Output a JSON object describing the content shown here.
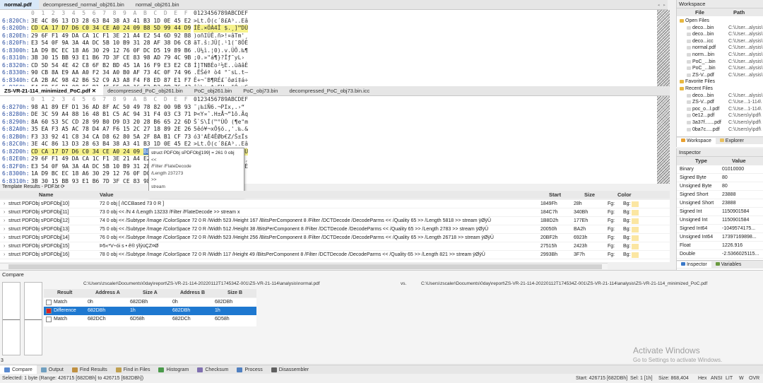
{
  "top_tabs": [
    "normal.pdf",
    "decompressed_normal_obj261.bin",
    "normal_obj261.bin"
  ],
  "hex_header": {
    "addr": "",
    "cols": "0  1  2  3  4  5  6  7  8  9  A  B  C  D  E  F",
    "ascii": "0123456789ABCDEF"
  },
  "hex_top": [
    {
      "a": "6:820Ch:",
      "b": "3E 4C 86 13 D3 28 63 B4 38 A3 41 B3 1D 0E 45 E2",
      "t": ">Lt.Ó(c´8£A³..Eâ"
    },
    {
      "a": "6:820Dh:",
      "b": "CD CA 17 D7 D6 C0 34 CE A0 24 09 B8 5D 99 44 D9",
      "t": "ÍÊ.×ÖÀ4Î $.¸]™DÙ",
      "hl": true
    },
    {
      "a": "6:820Eh:",
      "b": "29 6F F1 49 DA CA 1C F1 3E 21 A4 E2 54 6D 92 B8",
      "t": ")oñIÚÊ.ñ>!¤âTm'¸"
    },
    {
      "a": "6:820Fh:",
      "b": "E3 54 0F 9A 3A 4A DC 5B 10 B9 31 28 AF 38 D6 C8",
      "t": "ãT.š:JÜ[.¹1(¯8ÖÈ"
    },
    {
      "a": "6:8300h:",
      "b": "1A D9 BC EC 18 A6 30 29 12 76 0F DC D5 19 89 B6",
      "t": ".Ù¼ì.¦0).v.ÜÕ.‰¶"
    },
    {
      "a": "6:8310h:",
      "b": "3B 30 15 BB 93 E1 B6 7D 3F CE 83 98 AD 79 4C 9B",
      "t": ";0.»\"á¶}?Îƒ˜­yL›"
    },
    {
      "a": "6:8320h:",
      "b": "CD 5D 54 4E 42 C8 6F B2 BD 45 1A 16 F9 E3 E2 C8",
      "t": "Í]TNBÈo²½E..ùãâÈ"
    },
    {
      "a": "6:8330h:",
      "b": "90 CB 8A E9 AA A0 F2 34 A0 B0 AF 73 4C 0F 74 96",
      "t": ".ËŠéª ò4 °¯sL.t–"
    },
    {
      "a": "6:8340h:",
      "b": "CA 2B AC 98 42 B6 52 C9 A3 A8 F4 F8 ED 87 E1 F7",
      "t": "Ê+¬˜B¶RÉ£¨ôøí‡á÷"
    },
    {
      "a": "6:8350h:",
      "b": "F4 F9 5C B1 08 86 B1 45 55 09 16 E3 D3 9B 76 43",
      "t": "ôù\\±.†±EU..ãÓ›vC"
    }
  ],
  "mid_tabs": [
    "ZS-VR-21-114_minimized_PoC.pdf",
    "decompressed_PoC_obj261.bin",
    "PoC_obj261.bin",
    "PoC_obj73.bin",
    "decompressed_PoC_obj73.bin.icc"
  ],
  "hex_bottom": [
    {
      "a": "6:8270h:",
      "b": "98 A1 89 EF D1 36 AD 8F AC 50 49 78 82 00 9B 93",
      "t": "˜¡‰ïÑ6­.¬PIx‚.›“"
    },
    {
      "a": "6:8280h:",
      "b": "DE 3C 59 A4 88 16 48 B1 C5 AC 94 31 F4 03 C3 71",
      "t": "Þ<Y¤ˆ.H±Å¬”1ô.Ãq"
    },
    {
      "a": "6:8290h:",
      "b": "8A 60 53 5C CD 28 99 B0 D9 D3 20 28 B6 65 22 6D",
      "t": "Š`S\\Í(™°ÙÓ (¶e\"m"
    },
    {
      "a": "6:82A0h:",
      "b": "35 EA F3 A5 AC 78 D4 A7 F6 15 2C 27 18 89 2E 26",
      "t": "5êó¥¬xÔ§ö.,'.‰.&"
    },
    {
      "a": "6:82B0h:",
      "b": "F3 33 92 41 C8 34 CA D8 62 80 5A 2F 8A B1 CF 73",
      "t": "ó3'AÈ4ÊØb€Z/Š±Ïs"
    },
    {
      "a": "6:82C0h:",
      "b": "3E 4C 86 13 D3 28 63 B4 38 A3 41 B3 1D 0E 45 E2",
      "t": ">Lt.Ó(c´8£A³..Eâ"
    },
    {
      "a": "6:82D0h:",
      "b": "CD CA 17 D7 D6 C0 34 CE A0 24 09 B8 5D 99 44 D9",
      "t": "ÍÊ.×ÖÀ4Î $.¸]™DÙ",
      "hl": true
    },
    {
      "a": "6:82E0h:",
      "b": "29 6F F1 49 DA CA 1C F1 3E 21 A4 E2 54 6D 92 B8",
      "t": ")oñIÚÊ.ñ>!¤âTm'¸"
    },
    {
      "a": "6:82F0h:",
      "b": "E3 54 0F 9A 3A 4A DC 5B 10 B9 31 28 AF 38 D6 C8",
      "t": "ãT.š:JÜ[.¹1(¯8ÖÈ"
    },
    {
      "a": "6:8300h:",
      "b": "1A D9 BC EC 18 A6 30 29 12 76 0F DC",
      "t": ""
    },
    {
      "a": "6:8310h:",
      "b": "3B 30 15 BB 93 E1 B6 7D 3F CE 83 98",
      "t": ""
    },
    {
      "a": "6:8320h:",
      "b": "CD 5D 54 4E 42 C8 6F B2 BD 45 1A 16",
      "t": ""
    }
  ],
  "tooltip": [
    "struct PDFObj sPDFObj[199] = 261 0 obj",
    "<<",
    "/Filter /FlateDecode",
    "/Length 237273",
    ">>",
    "stream",
    "x"
  ],
  "template": {
    "title": "Template Results - PDF.bt ⟳",
    "headers": [
      "Name",
      "Value",
      "Start",
      "Size",
      "Color"
    ],
    "rows": [
      {
        "n": "struct PDFObj sPDFObj[10]",
        "v": "72 0 obj   [ /ICCBased 73 0 R ]",
        "s": "1849Fh",
        "z": "28h",
        "fg": "Fg:",
        "bg": "Bg:"
      },
      {
        "n": "struct PDFObj sPDFObj[11]",
        "v": "73 0 obj   << /N 4  /Length 13233  /Filter /FlateDecode  >>  stream  x",
        "s": "184C7h",
        "z": "340Bh",
        "fg": "Fg:",
        "bg": "Bg:"
      },
      {
        "n": "struct PDFObj sPDFObj[12]",
        "v": "74 0 obj   << /Subtype /Image  /ColorSpace 72 0 R  /Width 523  /Height 167  /BitsPerComponent 8  /Filter /DCTDecode  /DecodeParms << /Quality 65 >>  /Length 5818  >>  stream  ÿØÿÛ",
        "s": "1B8D2h",
        "z": "177Eh",
        "fg": "Fg:",
        "bg": "Bg:"
      },
      {
        "n": "struct PDFObj sPDFObj[13]",
        "v": "75 0 obj   << /Subtype /Image  /ColorSpace 72 0 R  /Width 512  /Height 38  /BitsPerComponent 8  /Filter /DCTDecode  /DecodeParms << /Quality 65 >>  /Length 2783  >>  stream  ÿØÿÛ",
        "s": "20050h",
        "z": "BA2h",
        "fg": "Fg:",
        "bg": "Bg:"
      },
      {
        "n": "struct PDFObj sPDFObj[14]",
        "v": "76 0 obj   << /Subtype /Image  /ColorSpace 72 0 R  /Width 523  /Height 256  /BitsPerComponent 8  /Filter /DCTDecode  /DecodeParms << /Quality 65 >>  /Length 26718  >>  stream  ÿØÿÛ",
        "s": "20BF2h",
        "z": "6923h",
        "fg": "Fg:",
        "bg": "Bg:"
      },
      {
        "n": "struct PDFObj sPDFObj[15]",
        "v": "Þ5«*V÷ói  s  •  ê®   ÿÏýüÇZ¤Ø",
        "s": "27515h",
        "z": "2423h",
        "fg": "Fg:",
        "bg": "Bg:"
      },
      {
        "n": "struct PDFObj sPDFObj[16]",
        "v": "78 0 obj   << /Subtype /Image  /ColorSpace 72 0 R  /Width 117  /Height 49  /BitsPerComponent 8  /Filter /DCTDecode  /DecodeParms << /Quality 65 >>  /Length 821  >>  stream  ÿØÿÛ",
        "s": "2993Bh",
        "z": "3F7h",
        "fg": "Fg:",
        "bg": "Bg:"
      }
    ]
  },
  "workspace": {
    "title": "Workspace",
    "headers": [
      "File",
      "Path"
    ],
    "tree": [
      {
        "k": "folder",
        "f": "Open Files",
        "p": ""
      },
      {
        "k": "file",
        "f": "deco...bin",
        "p": "C:\\User...alysis\\"
      },
      {
        "k": "file",
        "f": "deco...bin",
        "p": "C:\\User...alysis\\"
      },
      {
        "k": "file",
        "f": "deco...icc",
        "p": "C:\\User...alysis\\"
      },
      {
        "k": "file",
        "f": "normal.pdf",
        "p": "C:\\User...alysis\\"
      },
      {
        "k": "file",
        "f": "norm...bin",
        "p": "C:\\User...alysis\\"
      },
      {
        "k": "file",
        "f": "PoC_...bin",
        "p": "C:\\User...alysis\\"
      },
      {
        "k": "file",
        "f": "PoC_...bin",
        "p": "C:\\User...alysis\\"
      },
      {
        "k": "file",
        "f": "ZS-V...pdf",
        "p": "C:\\User...alysis\\"
      },
      {
        "k": "folder",
        "f": "Favorite Files",
        "p": ""
      },
      {
        "k": "folder",
        "f": "Recent Files",
        "p": ""
      },
      {
        "k": "file",
        "f": "deco...bin",
        "p": "C:\\User...alysis\\"
      },
      {
        "k": "file",
        "f": "ZS-V...pdf",
        "p": "C:\\Use...1-114\\"
      },
      {
        "k": "file",
        "f": "poc_o...l.pdf",
        "p": "C:\\Use...1-114\\"
      },
      {
        "k": "file",
        "f": "0e12...pdf",
        "p": "C:\\Users\\y\\pdf\\"
      },
      {
        "k": "file",
        "f": "3a37f.......pdf",
        "p": "C:\\Users\\y\\pdf\\"
      },
      {
        "k": "file",
        "f": "0ba7c.....pdf",
        "p": "C:\\Users\\y\\pdf\\"
      }
    ],
    "tabs": [
      "Workspace",
      "Explorer"
    ]
  },
  "inspector": {
    "title": "Inspector",
    "headers": [
      "Type",
      "Value"
    ],
    "rows": [
      {
        "t": "Binary",
        "v": "01010000"
      },
      {
        "t": "Signed Byte",
        "v": "80"
      },
      {
        "t": "Unsigned Byte",
        "v": "80"
      },
      {
        "t": "Signed Short",
        "v": "23888"
      },
      {
        "t": "Unsigned Short",
        "v": "23888"
      },
      {
        "t": "Signed Int",
        "v": "1150901584"
      },
      {
        "t": "Unsigned Int",
        "v": "1150901584"
      },
      {
        "t": "Signed Int64",
        "v": "-1049574175..."
      },
      {
        "t": "Unsigned Int64",
        "v": "17397169898..."
      },
      {
        "t": "Float",
        "v": "1226.916"
      },
      {
        "t": "Double",
        "v": "-2.5366025115..."
      }
    ],
    "tabs": [
      "Inspector",
      "Variables"
    ]
  },
  "compare": {
    "title": "Compare",
    "left_path": "C:\\Users\\zscaler\\Documents\\0day\\report\\ZS-VR-21-114-20220112T174534Z-001\\ZS-VR-21-114\\analysis\\normal.pdf",
    "vs": "vs.",
    "right_path": "C:\\Users\\zscaler\\Documents\\0day\\report\\ZS-VR-21-114-20220112T174534Z-001\\ZS-VR-21-114\\analysis\\ZS-VR-21-114_minimized_PoC.pdf",
    "headers": [
      "Result",
      "Address A",
      "Size A",
      "Address B",
      "Size B"
    ],
    "rows": [
      {
        "r": "Match",
        "aa": "0h",
        "sa": "682DBh",
        "ab": "0h",
        "sb": "682DBh",
        "c": "#ffffff",
        "sel": false
      },
      {
        "r": "Difference",
        "aa": "682DBh",
        "sa": "1h",
        "ab": "682DBh",
        "sb": "1h",
        "c": "#e02020",
        "sel": true
      },
      {
        "r": "Match",
        "aa": "682DCh",
        "sa": "6D58h",
        "ab": "682DCh",
        "sb": "6D58h",
        "c": "#ffffff",
        "sel": false
      }
    ],
    "count": "3"
  },
  "watermark": {
    "line1": "Activate Windows",
    "line2": "Go to Settings to activate Windows."
  },
  "bottom_tabs": [
    "Compare",
    "Output",
    "Find Results",
    "Find in Files",
    "Histogram",
    "Checksum",
    "Process",
    "Disassembler"
  ],
  "status": {
    "left": "Selected: 1 byte (Range: 426715 [682DBh] to 426715 [682DBh])",
    "start": "Start: 426715 [682DBh]",
    "sel": "Sel: 1 [1h]",
    "size": "Size: 868,404",
    "hex": "Hex",
    "ansi": "ANSI",
    "lit": "LIT",
    "w": "W",
    "ovr": "OVR"
  }
}
